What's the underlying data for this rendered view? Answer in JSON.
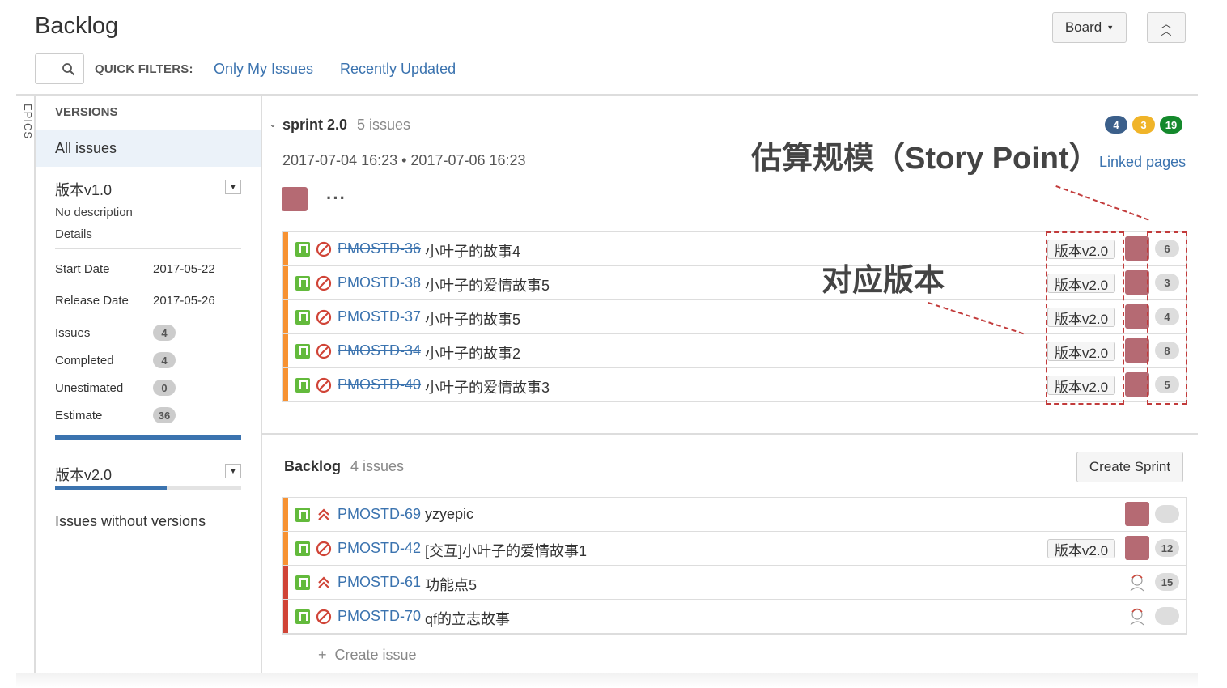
{
  "header": {
    "title": "Backlog",
    "board_button": "Board",
    "collapse_icon": "double-chevron-up-icon"
  },
  "quick_filters": {
    "label": "QUICK FILTERS:",
    "items": [
      "Only My Issues",
      "Recently Updated"
    ]
  },
  "sidebar": {
    "epics_tab": "EPICS",
    "versions_heading": "VERSIONS",
    "all_issues": "All issues",
    "version1": {
      "name": "版本v1.0",
      "description": "No description",
      "details_link": "Details",
      "start_date_label": "Start Date",
      "start_date": "2017-05-22",
      "release_date_label": "Release Date",
      "release_date": "2017-05-26",
      "stats": [
        {
          "label": "Issues",
          "value": "4"
        },
        {
          "label": "Completed",
          "value": "4"
        },
        {
          "label": "Unestimated",
          "value": "0"
        },
        {
          "label": "Estimate",
          "value": "36"
        }
      ],
      "progress": 1.0
    },
    "version2": {
      "name": "版本v2.0",
      "progress": 0.6
    },
    "issues_without_versions": "Issues without versions"
  },
  "sprint": {
    "name": "sprint 2.0",
    "issue_count": "5 issues",
    "dates": "2017-07-04 16:23 • 2017-07-06 16:23",
    "more_icon": "ellipsis-icon",
    "badges": [
      {
        "value": "4",
        "color": "#3b5f8a"
      },
      {
        "value": "3",
        "color": "#f0b429"
      },
      {
        "value": "19",
        "color": "#14892c"
      }
    ],
    "linked_pages": "Linked pages",
    "issues": [
      {
        "key": "PMOSTD-36",
        "summary": "小叶子的故事4",
        "done": true,
        "version": "版本v2.0",
        "estimate": "6"
      },
      {
        "key": "PMOSTD-38",
        "summary": "小叶子的爱情故事5",
        "done": false,
        "version": "版本v2.0",
        "estimate": "3"
      },
      {
        "key": "PMOSTD-37",
        "summary": "小叶子的故事5",
        "done": false,
        "version": "版本v2.0",
        "estimate": "4"
      },
      {
        "key": "PMOSTD-34",
        "summary": "小叶子的故事2",
        "done": true,
        "version": "版本v2.0",
        "estimate": "8"
      },
      {
        "key": "PMOSTD-40",
        "summary": "小叶子的爱情故事3",
        "done": true,
        "version": "版本v2.0",
        "estimate": "5"
      }
    ]
  },
  "annotations": {
    "story_point": "估算规模（Story Point）",
    "version": "对应版本"
  },
  "backlog": {
    "name": "Backlog",
    "issue_count": "4 issues",
    "create_sprint": "Create Sprint",
    "issues": [
      {
        "key": "PMOSTD-69",
        "summary": "yzyepic",
        "version": "",
        "estimate": "",
        "priority": "highest",
        "stripe": "#f79232"
      },
      {
        "key": "PMOSTD-42",
        "summary": "[交互]小叶子的爱情故事1",
        "version": "版本v2.0",
        "estimate": "12",
        "priority": "blocker",
        "stripe": "#f79232"
      },
      {
        "key": "PMOSTD-61",
        "summary": "功能点5",
        "version": "",
        "estimate": "15",
        "priority": "highest",
        "stripe": "#d04437"
      },
      {
        "key": "PMOSTD-70",
        "summary": "qf的立志故事",
        "version": "",
        "estimate": "",
        "priority": "blocker",
        "stripe": "#d04437"
      }
    ],
    "create_issue": "Create issue"
  }
}
